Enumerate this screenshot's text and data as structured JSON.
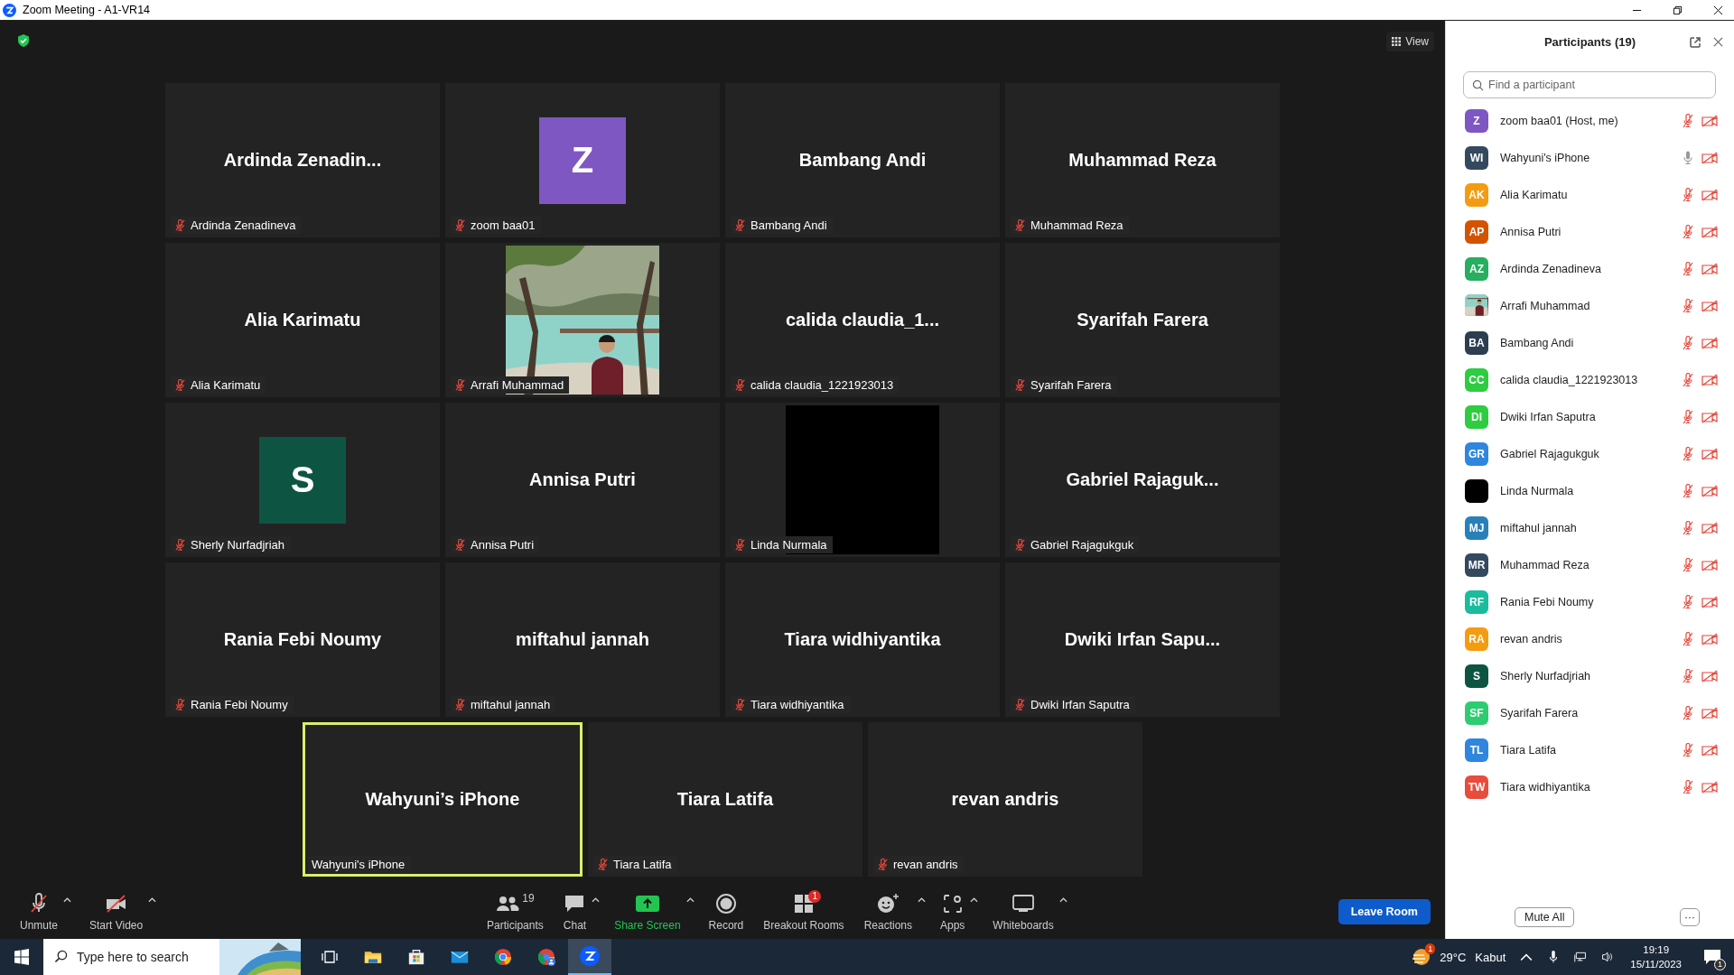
{
  "window": {
    "title": "Zoom Meeting - A1-VR14"
  },
  "view_button": {
    "label": "View"
  },
  "grid_tiles": [
    {
      "kind": "name",
      "name": "Ardinda Zenadin...",
      "label": "Ardinda Zenadineva",
      "muted": true,
      "active": false
    },
    {
      "kind": "avatar",
      "initial": "Z",
      "color": "#7e57c2",
      "label": "zoom baa01",
      "muted": true,
      "active": false
    },
    {
      "kind": "name",
      "name": "Bambang Andi",
      "label": "Bambang Andi",
      "muted": true,
      "active": false
    },
    {
      "kind": "name",
      "name": "Muhammad Reza",
      "label": "Muhammad Reza",
      "muted": true,
      "active": false
    },
    {
      "kind": "name",
      "name": "Alia Karimatu",
      "label": "Alia Karimatu",
      "muted": true,
      "active": false
    },
    {
      "kind": "picture",
      "label": "Arrafi Muhammad",
      "muted": true,
      "active": false
    },
    {
      "kind": "name",
      "name": "calida claudia_1...",
      "label": "calida claudia_1221923013",
      "muted": true,
      "active": false
    },
    {
      "kind": "name",
      "name": "Syarifah Farera",
      "label": "Syarifah Farera",
      "muted": true,
      "active": false
    },
    {
      "kind": "avatar",
      "initial": "S",
      "color": "#0e5443",
      "label": "Sherly Nurfadjriah",
      "muted": true,
      "active": false
    },
    {
      "kind": "name",
      "name": "Annisa Putri",
      "label": "Annisa Putri",
      "muted": true,
      "active": false
    },
    {
      "kind": "black",
      "label": "Linda Nurmala",
      "muted": true,
      "active": false
    },
    {
      "kind": "name",
      "name": "Gabriel Rajaguk...",
      "label": "Gabriel Rajagukguk",
      "muted": true,
      "active": false
    },
    {
      "kind": "name",
      "name": "Rania Febi Noumy",
      "label": "Rania Febi Noumy",
      "muted": true,
      "active": false
    },
    {
      "kind": "name",
      "name": "miftahul jannah",
      "label": "miftahul jannah",
      "muted": true,
      "active": false
    },
    {
      "kind": "name",
      "name": "Tiara widhiyantika",
      "label": "Tiara widhiyantika",
      "muted": true,
      "active": false
    },
    {
      "kind": "name",
      "name": "Dwiki Irfan Sapu...",
      "label": "Dwiki Irfan Saputra",
      "muted": true,
      "active": false
    }
  ],
  "bottom_tiles": [
    {
      "kind": "name",
      "name": "Wahyuni’s iPhone",
      "label": "Wahyuni's iPhone",
      "muted": false,
      "active": true
    },
    {
      "kind": "name",
      "name": "Tiara Latifa",
      "label": "Tiara Latifa",
      "muted": true,
      "active": false
    },
    {
      "kind": "name",
      "name": "revan andris",
      "label": "revan andris",
      "muted": true,
      "active": false
    }
  ],
  "toolbar": {
    "left_items": [
      {
        "kind": "mic",
        "label": "Unmute",
        "caret": true
      },
      {
        "kind": "video",
        "label": "Start Video",
        "caret": true
      }
    ],
    "center_items": [
      {
        "kind": "participants",
        "label": "Participants",
        "count": "19",
        "caret": false
      },
      {
        "kind": "chat",
        "label": "Chat",
        "caret": true
      },
      {
        "kind": "share",
        "label": "Share Screen",
        "caret": true
      },
      {
        "kind": "record",
        "label": "Record",
        "caret": false
      },
      {
        "kind": "breakout",
        "label": "Breakout Rooms",
        "badge": "1",
        "caret": false
      },
      {
        "kind": "reactions",
        "label": "Reactions",
        "caret": true
      },
      {
        "kind": "apps",
        "label": "Apps",
        "caret": true
      },
      {
        "kind": "whiteboards",
        "label": "Whiteboards",
        "caret": true
      }
    ],
    "leave_button": "Leave Room"
  },
  "panel": {
    "title": "Participants (19)",
    "search": {
      "placeholder": "Find a participant"
    },
    "participants": [
      {
        "kind": "initials",
        "initials": "Z",
        "color": "#7e57c2",
        "name": "zoom baa01 (Host, me)",
        "muted": true
      },
      {
        "kind": "initials",
        "initials": "WI",
        "color": "#34495e",
        "name": "Wahyuni's iPhone",
        "muted": false
      },
      {
        "kind": "initials",
        "initials": "AK",
        "color": "#f39c12",
        "name": "Alia Karimatu",
        "muted": true
      },
      {
        "kind": "initials",
        "initials": "AP",
        "color": "#d35400",
        "name": "Annisa Putri",
        "muted": true
      },
      {
        "kind": "initials",
        "initials": "AZ",
        "color": "#27ae60",
        "name": "Ardinda Zenadineva",
        "muted": true
      },
      {
        "kind": "picture",
        "name": "Arrafi Muhammad",
        "muted": true
      },
      {
        "kind": "initials",
        "initials": "BA",
        "color": "#2c3e50",
        "name": "Bambang Andi",
        "muted": true
      },
      {
        "kind": "initials",
        "initials": "CC",
        "color": "#2ecc40",
        "name": "calida claudia_1221923013",
        "muted": true
      },
      {
        "kind": "initials",
        "initials": "DI",
        "color": "#2ecc40",
        "name": "Dwiki Irfan Saputra",
        "muted": true
      },
      {
        "kind": "initials",
        "initials": "GR",
        "color": "#2e86de",
        "name": "Gabriel Rajagukguk",
        "muted": true
      },
      {
        "kind": "blank",
        "color": "#000000",
        "name": "Linda Nurmala",
        "muted": true
      },
      {
        "kind": "initials",
        "initials": "MJ",
        "color": "#2980b9",
        "name": "miftahul jannah",
        "muted": true
      },
      {
        "kind": "initials",
        "initials": "MR",
        "color": "#34495e",
        "name": "Muhammad Reza",
        "muted": true
      },
      {
        "kind": "initials",
        "initials": "RF",
        "color": "#1abc9c",
        "name": "Rania Febi Noumy",
        "muted": true
      },
      {
        "kind": "initials",
        "initials": "RA",
        "color": "#f39c12",
        "name": "revan andris",
        "muted": true
      },
      {
        "kind": "initials",
        "initials": "S",
        "color": "#0e5443",
        "name": "Sherly Nurfadjriah",
        "muted": true
      },
      {
        "kind": "initials",
        "initials": "SF",
        "color": "#2ecc71",
        "name": "Syarifah Farera",
        "muted": true
      },
      {
        "kind": "initials",
        "initials": "TL",
        "color": "#2e86de",
        "name": "Tiara Latifa",
        "muted": true
      },
      {
        "kind": "initials",
        "initials": "TW",
        "color": "#e74c3c",
        "name": "Tiara widhiyantika",
        "muted": true
      }
    ],
    "mute_all": "Mute All",
    "more": "···"
  },
  "taskbar": {
    "search_placeholder": "Type here to search",
    "weather_badge": "1",
    "temperature": "29°C",
    "weather": "Kabut",
    "time": "19:19",
    "date": "15/11/2023",
    "notification_count": "1"
  }
}
